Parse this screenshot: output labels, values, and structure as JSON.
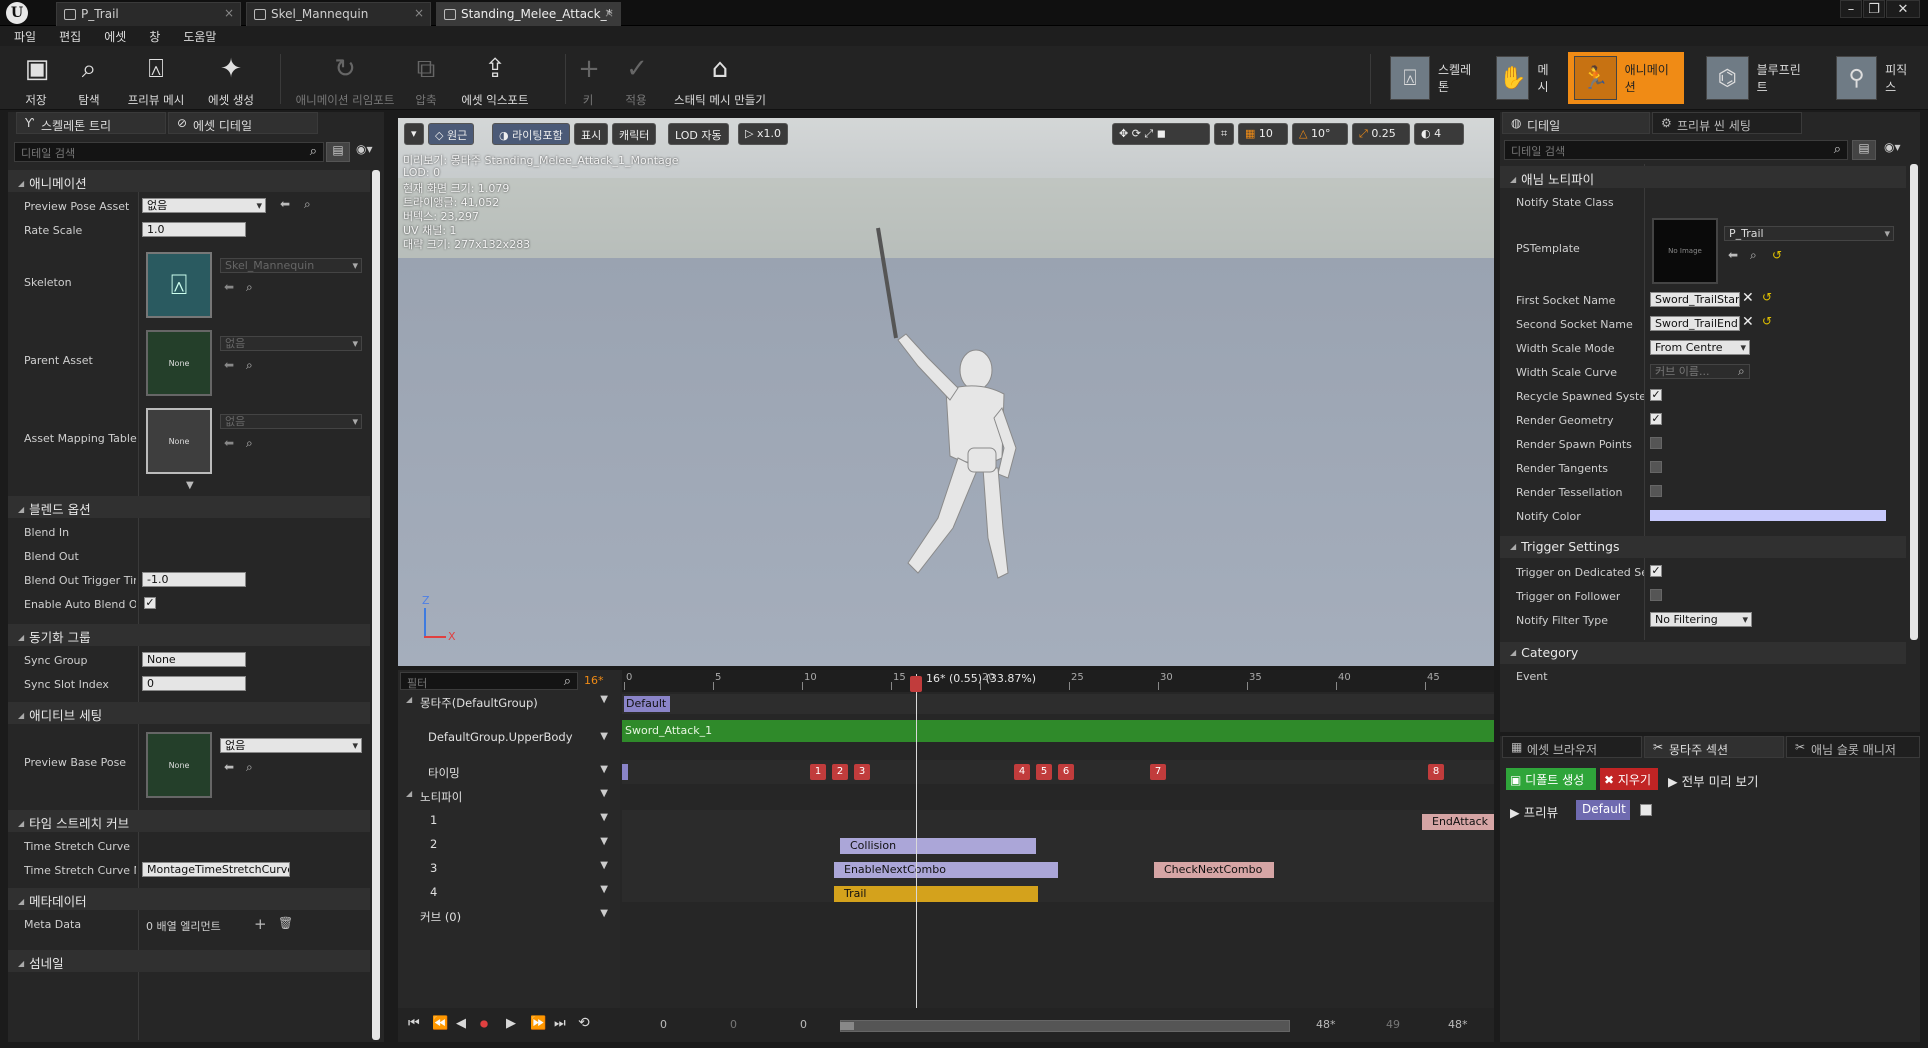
{
  "tabs": [
    {
      "label": "P_Trail",
      "active": false
    },
    {
      "label": "Skel_Mannequin",
      "active": false
    },
    {
      "label": "Standing_Melee_Attack_*",
      "active": true
    }
  ],
  "menu": [
    "파일",
    "편집",
    "에셋",
    "창",
    "도움말"
  ],
  "toolbar": {
    "buttons": [
      {
        "label": "저장",
        "icon": "save-icon",
        "glyph": "▣",
        "dim": false
      },
      {
        "label": "탐색",
        "icon": "browse-icon",
        "glyph": "⌕",
        "dim": false
      },
      {
        "label": "프리뷰 메시",
        "icon": "preview-mesh-icon",
        "glyph": "⍓",
        "dim": false
      },
      {
        "label": "에셋 생성",
        "icon": "create-asset-icon",
        "glyph": "✦",
        "dim": false
      },
      {
        "label": "애니메이션 리임포트",
        "icon": "reimport-icon",
        "glyph": "↻",
        "dim": true
      },
      {
        "label": "압축",
        "icon": "compress-icon",
        "glyph": "⧉",
        "dim": true
      },
      {
        "label": "에셋 익스포트",
        "icon": "export-icon",
        "glyph": "⇪",
        "dim": false
      },
      {
        "label": "키",
        "icon": "key-icon",
        "glyph": "+",
        "dim": true
      },
      {
        "label": "적용",
        "icon": "apply-icon",
        "glyph": "✓",
        "dim": true
      },
      {
        "label": "스태틱 메시 만들기",
        "icon": "make-static-mesh-icon",
        "glyph": "⌂",
        "dim": false
      }
    ],
    "modes": [
      {
        "label": "스켈레톤",
        "active": false
      },
      {
        "label": "메시",
        "active": false
      },
      {
        "label": "애니메이션",
        "active": true
      },
      {
        "label": "블루프린트",
        "active": false
      },
      {
        "label": "피직스",
        "active": false
      }
    ]
  },
  "left_panel": {
    "tabs": [
      "스켈레톤 트리",
      "에셋 디테일"
    ],
    "search_placeholder": "디테일 검색",
    "cat_animation": "애니메이션",
    "preview_pose_asset": {
      "label": "Preview Pose Asset",
      "value": "없음"
    },
    "rate_scale": {
      "label": "Rate Scale",
      "value": "1.0"
    },
    "skeleton": {
      "label": "Skeleton",
      "value": "Skel_Mannequin"
    },
    "parent_asset": {
      "label": "Parent Asset",
      "thumb": "None",
      "value": "없음"
    },
    "asset_mapping": {
      "label": "Asset Mapping Table",
      "thumb": "None",
      "value": "없음"
    },
    "cat_blend": "블렌드 옵션",
    "blend_in": "Blend In",
    "blend_out": "Blend Out",
    "blend_out_trigger": {
      "label": "Blend Out Trigger Tim",
      "value": "-1.0"
    },
    "auto_blend": {
      "label": "Enable Auto Blend Ou",
      "checked": true
    },
    "cat_sync": "동기화 그룹",
    "sync_group": {
      "label": "Sync Group",
      "value": "None"
    },
    "sync_slot": {
      "label": "Sync Slot Index",
      "value": "0"
    },
    "cat_additive": "애디티브 세팅",
    "preview_base_pose": {
      "label": "Preview Base Pose",
      "thumb": "None",
      "value": "없음"
    },
    "cat_timestretch": "타임 스트레치 커브",
    "ts_curve": "Time Stretch Curve",
    "ts_curve_name": {
      "label": "Time Stretch Curve N",
      "value": "MontageTimeStretchCurve"
    },
    "cat_meta": "메타데이터",
    "meta_data": {
      "label": "Meta Data",
      "value": "0 배열 엘리먼트"
    },
    "cat_thumb": "섬네일"
  },
  "viewport": {
    "buttons": [
      "원근",
      "라이팅포함",
      "표시",
      "캐릭터",
      "LOD 자동",
      "x1.0"
    ],
    "right_values": [
      "10",
      "10°",
      "0.25",
      "4"
    ],
    "info": [
      "미리보기: 몽타주 Standing_Melee_Attack_1_Montage",
      "LOD: 0",
      "현재 화면 크기: 1.079",
      "트라이앵글: 41,052",
      "버텍스: 23,297",
      "UV 채널: 1",
      "대략 크기: 277x132x283"
    ],
    "axis_z": "Z",
    "axis_x": "X"
  },
  "timeline": {
    "filter_placeholder": "필터",
    "frame_badge": "16*",
    "playhead_label": "16* (0.55) (33.87%)",
    "ticks": [
      "0",
      "5",
      "10",
      "15",
      "20",
      "25",
      "30",
      "35",
      "40",
      "45"
    ],
    "rows": {
      "montage": "몽타주(DefaultGroup)",
      "slot": "DefaultGroup.UpperBody",
      "timing": "타이밍",
      "notifies": "노티파이",
      "n1": "1",
      "n2": "2",
      "n3": "3",
      "n4": "4",
      "curves": "커브  (0)"
    },
    "section_default": "Default",
    "segment": "Sword_Attack_1",
    "markers": [
      "1",
      "2",
      "3",
      "4",
      "5",
      "6",
      "7",
      "8"
    ],
    "notifies": {
      "end_attack": "EndAttack",
      "collision": "Collision",
      "enable_next_combo": "EnableNextCombo",
      "check_next_combo": "CheckNextCombo",
      "trail": "Trail"
    },
    "transport_nums": [
      "0",
      "0",
      "0",
      "48*",
      "49",
      "48*"
    ]
  },
  "details": {
    "tabs": [
      "디테일",
      "프리뷰 씬 세팅"
    ],
    "search_placeholder": "디테일 검색",
    "cat_anim_notify": "애님 노티파이",
    "notify_state_class": "Notify State Class",
    "ps_template": {
      "label": "PSTemplate",
      "value": "P_Trail",
      "thumb": "No Image"
    },
    "first_socket": {
      "label": "First Socket Name",
      "value": "Sword_TrailStar"
    },
    "second_socket": {
      "label": "Second Socket Name",
      "value": "Sword_TrailEnd"
    },
    "width_scale_mode": {
      "label": "Width Scale Mode",
      "value": "From Centre"
    },
    "width_scale_curve": {
      "label": "Width Scale Curve",
      "placeholder": "커브 이름..."
    },
    "recycle": {
      "label": "Recycle Spawned Systen",
      "checked": true
    },
    "render_geometry": {
      "label": "Render Geometry",
      "checked": true
    },
    "render_spawn": {
      "label": "Render Spawn Points",
      "checked": false
    },
    "render_tangents": {
      "label": "Render Tangents",
      "checked": false
    },
    "render_tess": {
      "label": "Render Tessellation",
      "checked": false
    },
    "notify_color": {
      "label": "Notify Color",
      "color": "#c7c9fb"
    },
    "cat_trigger": "Trigger Settings",
    "trigger_dedicated": {
      "label": "Trigger on Dedicated Ser",
      "checked": true
    },
    "trigger_follower": {
      "label": "Trigger on Follower",
      "checked": false
    },
    "notify_filter": {
      "label": "Notify Filter Type",
      "value": "No Filtering"
    },
    "cat_category": "Category",
    "event": "Event"
  },
  "bottom_right": {
    "tabs": [
      "에셋 브라우저",
      "몽타주 섹션",
      "애님 슬롯 매니저"
    ],
    "create_default": "디폴트 생성",
    "clear": "지우기",
    "preview_all": "전부 미리 보기",
    "preview": "프리뷰",
    "default_section": "Default"
  },
  "colors": {
    "accent_orange": "#f08b15",
    "section_purple": "#8a84c8",
    "segment_green": "#2f8a2a",
    "notify_purple": "#aba6d8",
    "notify_pink": "#d6a5a5",
    "notify_gold": "#d4a21c",
    "marker_red": "#c13c3c"
  }
}
